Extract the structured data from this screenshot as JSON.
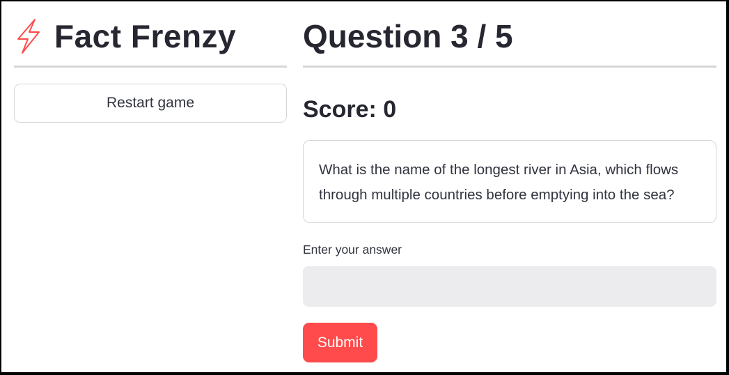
{
  "sidebar": {
    "app_title": "Fact Frenzy",
    "title_icon": "lightning-bolt-icon",
    "restart_label": "Restart game"
  },
  "main": {
    "question_heading": "Question 3 / 5",
    "score_text": "Score: 0",
    "question_text": "What is the name of the longest river in Asia, which flows through multiple countries before emptying into the sea?",
    "answer_label": "Enter your answer",
    "answer_value": "",
    "submit_label": "Submit"
  },
  "colors": {
    "accent": "#ff4b4b",
    "text": "#31333f",
    "input_bg": "#ececee",
    "border": "#d6d6d9"
  }
}
